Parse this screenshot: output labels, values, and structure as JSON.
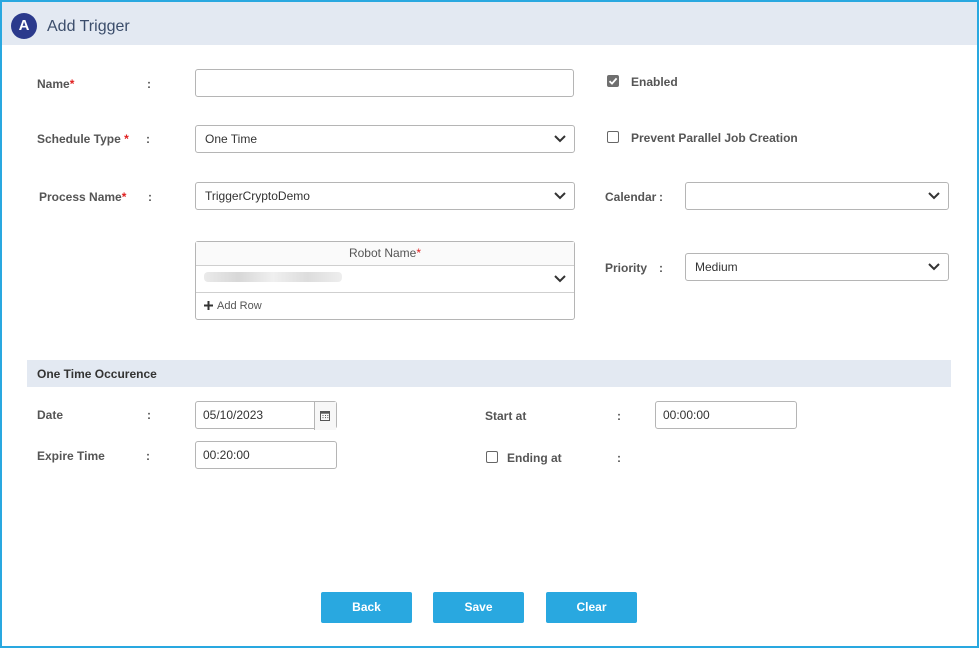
{
  "header": {
    "logo_letter": "A",
    "title": "Add Trigger"
  },
  "form": {
    "name": {
      "label": "Name",
      "required_mark": "*",
      "colon": ":",
      "value": ""
    },
    "schedule_type": {
      "label": "Schedule Type",
      "required_mark": "*",
      "colon": ":",
      "value": "One Time"
    },
    "process_name": {
      "label": "Process Name",
      "required_mark": "*",
      "colon": ":",
      "value": "TriggerCryptoDemo"
    },
    "robot_table": {
      "header_label": "Robot Name",
      "required_mark": "*",
      "add_row_label": "Add Row",
      "add_row_icon": "plus-icon"
    },
    "enabled": {
      "label": "Enabled",
      "checked": true
    },
    "prevent_parallel": {
      "label": "Prevent Parallel Job Creation",
      "checked": false
    },
    "calendar": {
      "label": "Calendar",
      "colon": ":",
      "value": ""
    },
    "priority": {
      "label": "Priority",
      "colon": ":",
      "value": "Medium"
    }
  },
  "one_time": {
    "section_title": "One Time Occurence",
    "date": {
      "label": "Date",
      "colon": ":",
      "value": "05/10/2023",
      "icon": "calendar-icon"
    },
    "expire_time": {
      "label": "Expire Time",
      "colon": ":",
      "value": "00:20:00"
    },
    "start_at": {
      "label": "Start at",
      "colon": ":",
      "value": "00:00:00"
    },
    "ending_at": {
      "label": "Ending at",
      "colon": ":",
      "checked": false
    }
  },
  "buttons": {
    "back": "Back",
    "save": "Save",
    "clear": "Clear"
  },
  "colors": {
    "accent": "#29a8e0",
    "header_bg": "#e3e9f2",
    "logo_bg": "#2b3a8c",
    "required": "#e02020"
  }
}
